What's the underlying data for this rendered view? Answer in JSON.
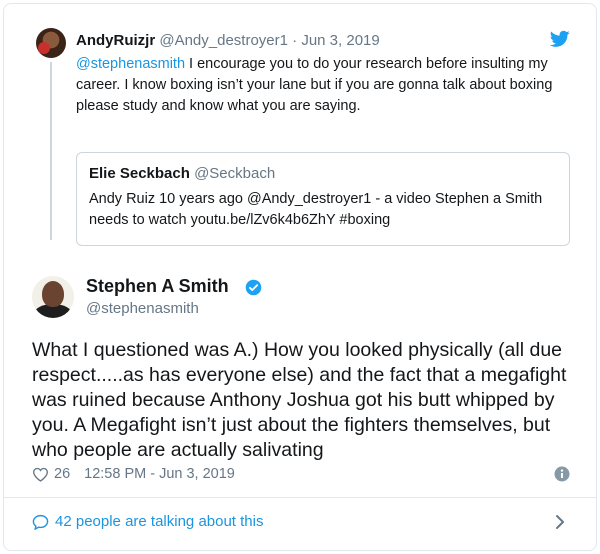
{
  "parent_tweet": {
    "name": "AndyRuizjr",
    "handle": "@Andy_destroyer1",
    "separator": "·",
    "date": "Jun 3, 2019",
    "mention": "@stephenasmith",
    "text": " I encourage you to do your research before insulting my career. I know boxing isn’t your lane but if you are gonna talk about boxing please study and know what you are saying.",
    "icon": "twitter-bird-icon"
  },
  "quoted_tweet": {
    "name": "Elie Seckbach",
    "handle": "@Seckbach",
    "text": "Andy Ruiz 10 years ago @Andy_destroyer1 - a video Stephen a Smith needs to watch youtu.be/lZv6k4b6ZhY #boxing"
  },
  "main_tweet": {
    "name": "Stephen A Smith",
    "handle": "@stephenasmith",
    "verified_icon": "verified-badge-icon",
    "text": "What I questioned was A.) How you looked physically (all due respect.....as has everyone else) and the fact that a megafight was ruined because Anthony Joshua got his butt whipped by you. A Megafight isn’t just about the fighters themselves, but who people are actually salivating",
    "likes": "26",
    "timestamp": "12:58 PM - Jun 3, 2019"
  },
  "footer": {
    "talking": "42 people are talking about this"
  },
  "colors": {
    "accent": "#1b95e0",
    "muted": "#657786",
    "border": "#e1e8ed"
  }
}
